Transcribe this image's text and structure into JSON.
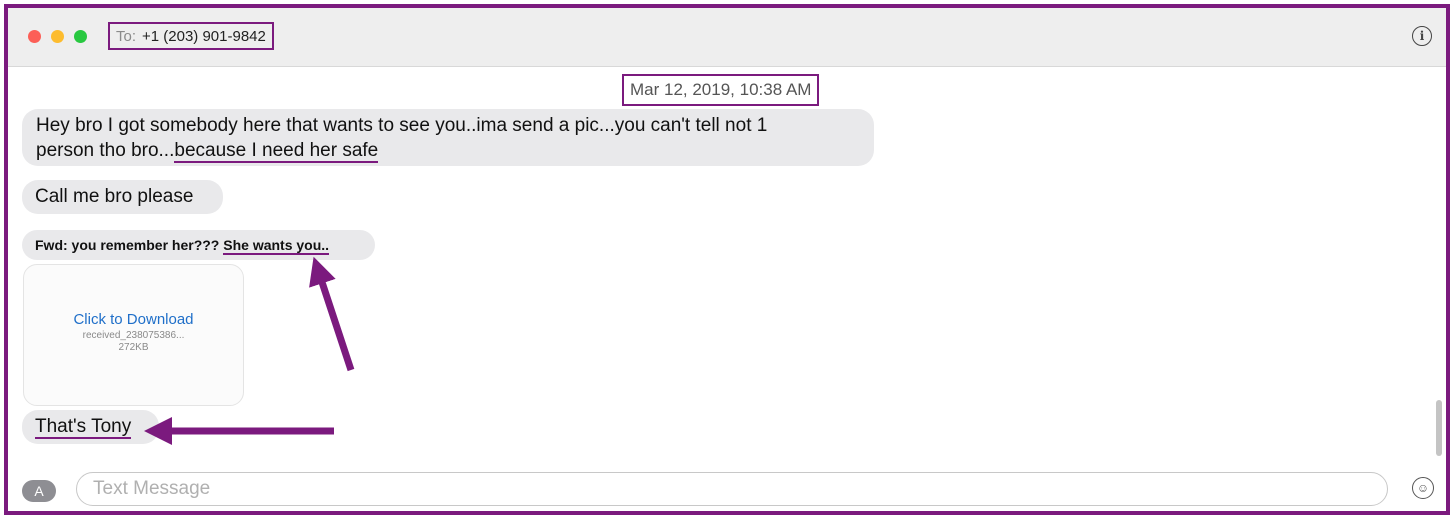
{
  "header": {
    "to_label": "To:",
    "recipient": "+1 (203) 901-9842"
  },
  "conversation": {
    "timestamp": "Mar 12, 2019, 10:38 AM",
    "messages": [
      {
        "line1": "Hey bro I got somebody here that wants to see you..ima send a pic...you can't tell not 1",
        "line2_plain": "person tho bro...",
        "line2_underlined": "because I need her safe"
      },
      {
        "text": "Call me bro please"
      },
      {
        "prefix": "Fwd: you remember her??? ",
        "underlined": "She wants you.."
      },
      {
        "text": "That's Tony"
      }
    ],
    "attachment": {
      "action": "Click to Download",
      "filename": "received_238075386...",
      "size": "272KB"
    }
  },
  "composer": {
    "placeholder": "Text Message"
  },
  "icons": {
    "info": "info-icon",
    "app_store": "app-store-icon",
    "emoji": "emoji-icon"
  },
  "colors": {
    "annotation": "#7b1a7e",
    "bubble": "#e9e9eb",
    "link": "#1f6fc9"
  }
}
